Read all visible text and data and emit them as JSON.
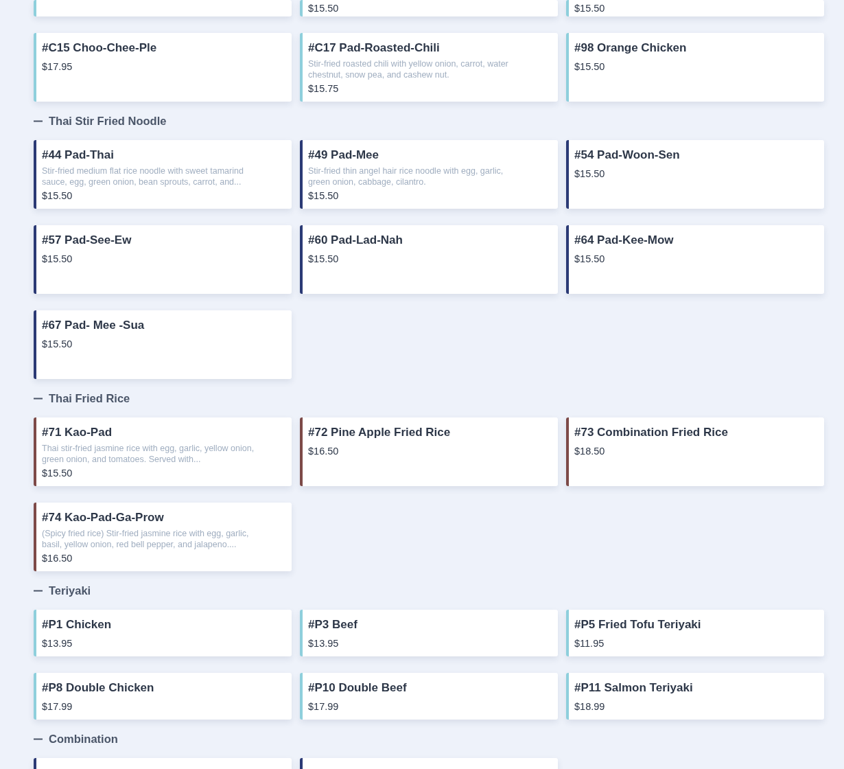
{
  "sections": [
    {
      "color": "#8ecfdc",
      "items": [
        {
          "kind": "cut"
        },
        {
          "kind": "cut",
          "price": "$15.50"
        },
        {
          "kind": "cut",
          "price": "$15.50"
        },
        {
          "kind": "card",
          "name": "#C15 Choo-Chee-Ple",
          "price": "$17.95"
        },
        {
          "kind": "card",
          "name": "#C17 Pad-Roasted-Chili",
          "description": "Stir-fried roasted chili with yellow onion, carrot, water chestnut, snow pea, and cashew nut.",
          "price": "$15.75"
        },
        {
          "kind": "card",
          "name": "#98 Orange Chicken",
          "price": "$15.50"
        }
      ]
    },
    {
      "title": "Thai Stir Fried Noodle",
      "expanded": true,
      "color": "#2b3a75",
      "items": [
        {
          "kind": "card",
          "name": "#44 Pad-Thai",
          "description": "Stir-fried medium flat rice noodle with sweet tamarind sauce, egg, green onion, bean sprouts, carrot, and...",
          "price": "$15.50"
        },
        {
          "kind": "card",
          "name": "#49 Pad-Mee",
          "description": "Stir-fried thin angel hair rice noodle with egg, garlic, green onion, cabbage, cilantro.",
          "price": "$15.50"
        },
        {
          "kind": "card",
          "name": "#54 Pad-Woon-Sen",
          "price": "$15.50"
        },
        {
          "kind": "card",
          "name": "#57 Pad-See-Ew",
          "price": "$15.50"
        },
        {
          "kind": "card",
          "name": "#60 Pad-Lad-Nah",
          "price": "$15.50"
        },
        {
          "kind": "card",
          "name": "#64 Pad-Kee-Mow",
          "price": "$15.50"
        },
        {
          "kind": "card",
          "name": "#67 Pad- Mee -Sua",
          "price": "$15.50"
        }
      ]
    },
    {
      "title": "Thai Fried Rice",
      "expanded": true,
      "color": "#7d4a48",
      "items": [
        {
          "kind": "card",
          "name": "#71 Kao-Pad",
          "description": "Thai stir-fried jasmine rice with egg, garlic, yellow onion, green onion, and tomatoes. Served with...",
          "price": "$15.50"
        },
        {
          "kind": "card",
          "name": "#72 Pine Apple Fried Rice",
          "price": "$16.50"
        },
        {
          "kind": "card",
          "name": "#73 Combination Fried Rice",
          "price": "$18.50"
        },
        {
          "kind": "card",
          "name": "#74 Kao-Pad-Ga-Prow",
          "description": "(Spicy fried rice) Stir-fried jasmine rice with egg, garlic, basil, yellow onion, red bell pepper, and jalapeno....",
          "price": "$16.50"
        }
      ]
    },
    {
      "title": "Teriyaki",
      "expanded": true,
      "color": "#8ecfdc",
      "items": [
        {
          "kind": "card",
          "name": "#P1 Chicken",
          "price": "$13.95"
        },
        {
          "kind": "card",
          "name": "#P3 Beef",
          "price": "$13.95"
        },
        {
          "kind": "card",
          "name": "#P5 Fried Tofu Teriyaki",
          "price": "$11.95"
        },
        {
          "kind": "card",
          "name": "#P8 Double Chicken",
          "price": "$17.99"
        },
        {
          "kind": "card",
          "name": "#P10 Double Beef",
          "price": "$17.99"
        },
        {
          "kind": "card",
          "name": "#P11 Salmon Teriyaki",
          "price": "$18.99"
        }
      ]
    },
    {
      "title": "Combination",
      "expanded": true,
      "color": "#2b3a75",
      "items": [
        {
          "kind": "cut"
        },
        {
          "kind": "cut"
        }
      ]
    }
  ]
}
